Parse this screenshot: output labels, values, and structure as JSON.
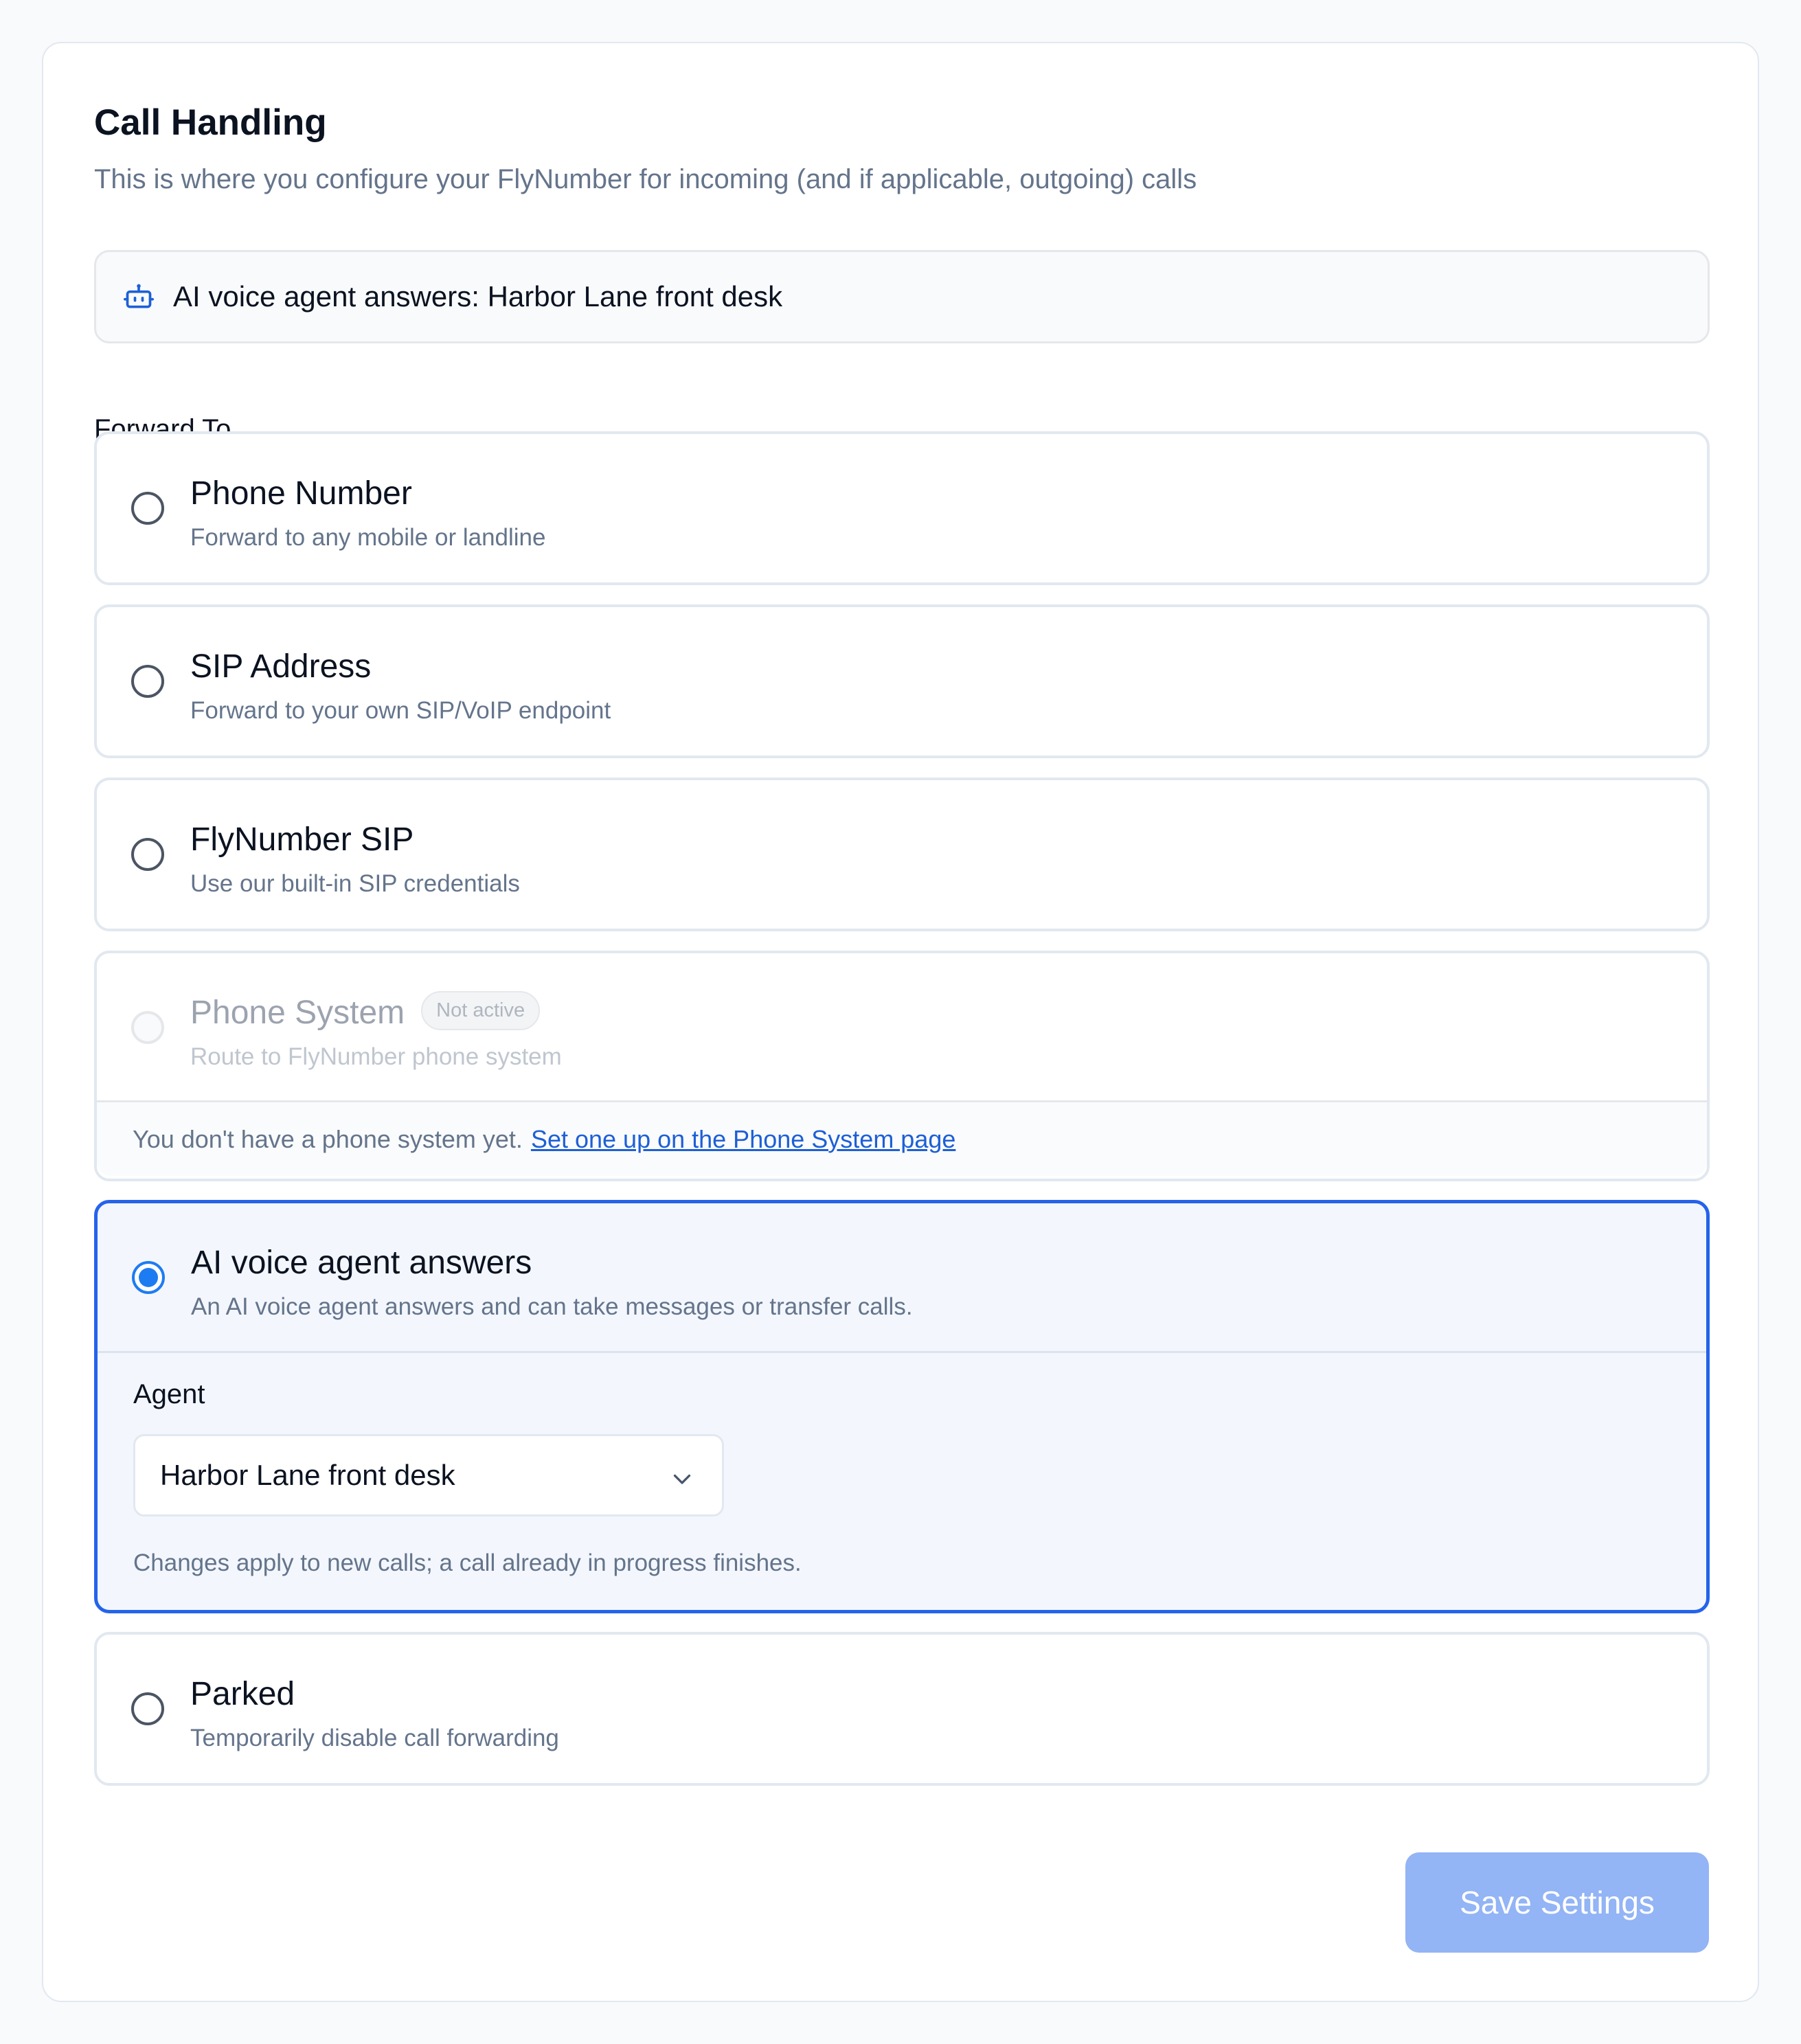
{
  "header": {
    "title": "Call Handling",
    "subtitle": "This is where you configure your FlyNumber for incoming (and if applicable, outgoing) calls"
  },
  "status": {
    "icon": "robot-icon",
    "text": "AI voice agent answers: Harbor Lane front desk"
  },
  "forward": {
    "label": "Forward To",
    "options": [
      {
        "title": "Phone Number",
        "desc": "Forward to any mobile or landline",
        "state": "unselected"
      },
      {
        "title": "SIP Address",
        "desc": "Forward to your own SIP/VoIP endpoint",
        "state": "unselected"
      },
      {
        "title": "FlyNumber SIP",
        "desc": "Use our built-in SIP credentials",
        "state": "unselected"
      },
      {
        "title": "Phone System",
        "desc": "Route to FlyNumber phone system",
        "state": "disabled",
        "badge": "Not active",
        "note": "You don't have a phone system yet.",
        "note_link": "Set one up on the Phone System page"
      },
      {
        "title": "AI voice agent answers",
        "desc": "An AI voice agent answers and can take messages or transfer calls.",
        "state": "selected"
      },
      {
        "title": "Parked",
        "desc": "Temporarily disable call forwarding",
        "state": "unselected"
      }
    ]
  },
  "agent": {
    "label": "Agent",
    "selected": "Harbor Lane front desk",
    "help": "Changes apply to new calls; a call already in progress finishes."
  },
  "actions": {
    "save_label": "Save Settings"
  },
  "colors": {
    "accent": "#2563eb",
    "radio_checked": "#1d7cf2",
    "save_disabled": "#93b4f5",
    "link": "#1d5fd6"
  }
}
